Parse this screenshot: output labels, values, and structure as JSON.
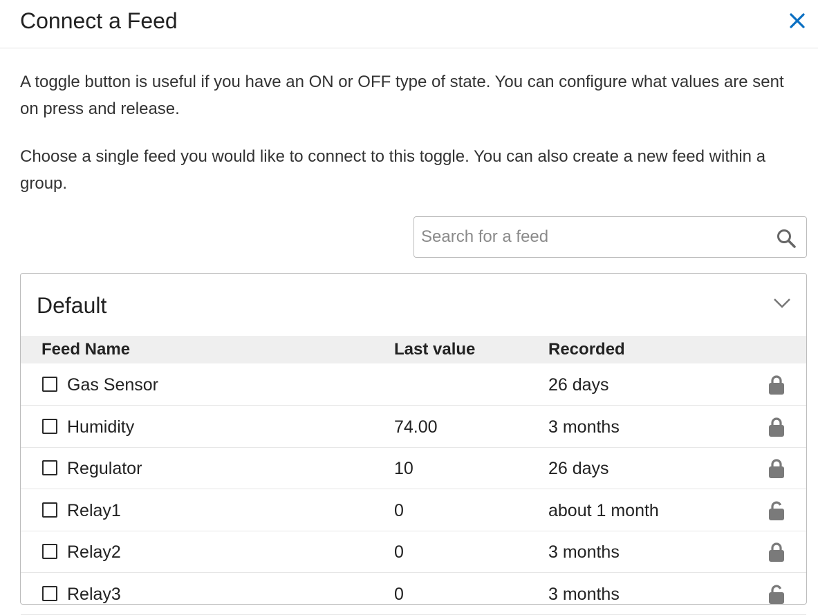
{
  "dialog": {
    "title": "Connect a Feed",
    "close_icon": "close-icon",
    "accent_color": "#0a6fc2"
  },
  "description": {
    "paragraph1": "A toggle button is useful if you have an ON or OFF type of state. You can configure what values are sent on press and release.",
    "paragraph2": "Choose a single feed you would like to connect to this toggle. You can also create a new feed within a group."
  },
  "search": {
    "placeholder": "Search for a feed",
    "value": "",
    "icon": "search-icon"
  },
  "group": {
    "name": "Default",
    "toggle_icon": "chevron-down-icon",
    "columns": [
      "Feed Name",
      "Last value",
      "Recorded"
    ],
    "rows": [
      {
        "name": "Gas Sensor",
        "last_value": "",
        "recorded": "26 days",
        "locked": true
      },
      {
        "name": "Humidity",
        "last_value": "74.00",
        "recorded": "3 months",
        "locked": true
      },
      {
        "name": "Regulator",
        "last_value": "10",
        "recorded": "26 days",
        "locked": true
      },
      {
        "name": "Relay1",
        "last_value": "0",
        "recorded": "about 1 month",
        "locked": false
      },
      {
        "name": "Relay2",
        "last_value": "0",
        "recorded": "3 months",
        "locked": true
      },
      {
        "name": "Relay3",
        "last_value": "0",
        "recorded": "3 months",
        "locked": false
      }
    ]
  }
}
